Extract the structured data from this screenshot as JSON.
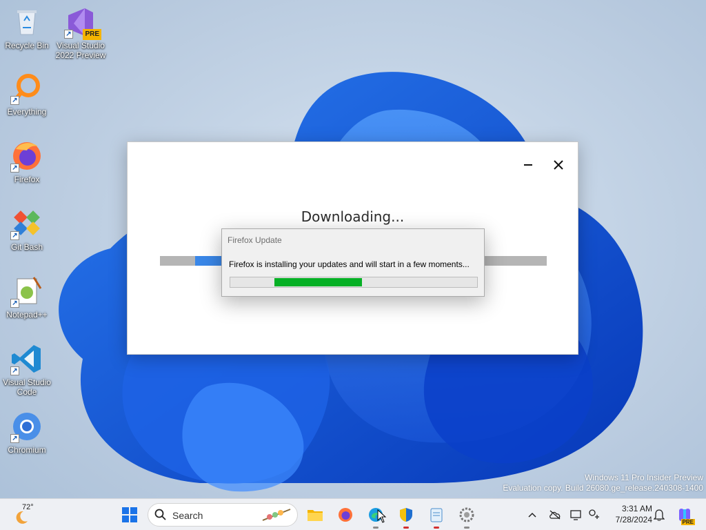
{
  "desktop": {
    "icons": [
      {
        "label": "Recycle Bin"
      },
      {
        "label": "Visual Studio 2022 Preview",
        "badge": "PRE"
      },
      {
        "label": "Everything"
      },
      {
        "label": "Firefox"
      },
      {
        "label": "Git Bash"
      },
      {
        "label": "Notepad++"
      },
      {
        "label": "Visual Studio Code"
      },
      {
        "label": "Chromium"
      }
    ]
  },
  "installer": {
    "heading": "Downloading...",
    "minimize_icon": "minimize-icon",
    "close_icon": "close-icon",
    "progress": 0.27,
    "accent": "#3a87e8"
  },
  "update_dialog": {
    "title": "Firefox Update",
    "message": "Firefox is installing your updates and will start in a few moments...",
    "progress_bar_color": "#06b025"
  },
  "watermark": {
    "line1": "Windows 11 Pro Insider Preview",
    "line2": "Evaluation copy. Build 26080.ge_release.240308-1400"
  },
  "taskbar": {
    "weather_temp": "72°",
    "search_placeholder": "Search",
    "pinned": [
      "start-icon",
      "file-explorer-icon",
      "firefox-icon",
      "edge-icon",
      "security-icon",
      "notepad-icon",
      "settings-icon"
    ],
    "clock_time": "3:31 AM",
    "clock_date": "7/28/2024",
    "copilot_badge": "PRE"
  }
}
